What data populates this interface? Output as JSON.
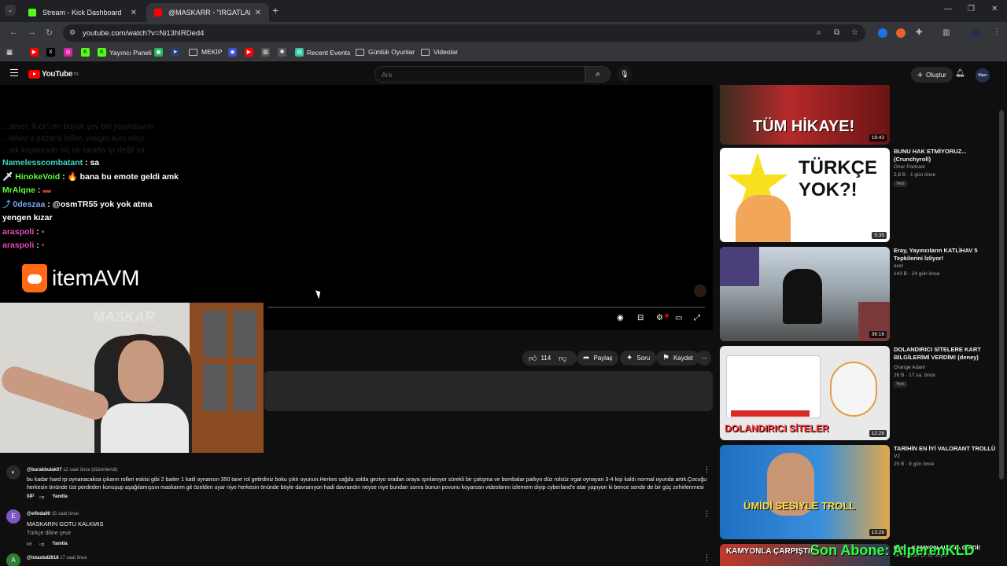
{
  "browser": {
    "tabs": [
      {
        "title": "Stream - Kick Dashboard",
        "favicon_color": "#53fc18",
        "active": false
      },
      {
        "title": "@MASKARR - \"IRGATLARIN GÜ",
        "favicon_color": "#ff0000",
        "active": true
      }
    ],
    "url": "youtube.com/watch?v=Ni13hIRDed4",
    "bookmarks": [
      {
        "label": "",
        "icon": "youtube-icon",
        "color": "#ff0000"
      },
      {
        "label": "",
        "icon": "x-icon",
        "color": "#000000"
      },
      {
        "label": "",
        "icon": "instagram-icon",
        "color": "#d6249f"
      },
      {
        "label": "Yayıncı Paneli",
        "icon": "kick-icon",
        "color": "#53fc18"
      },
      {
        "label": "",
        "icon": "kick-icon",
        "color": "#53fc18"
      },
      {
        "label": "",
        "icon": "app-icon",
        "color": "#1db954"
      },
      {
        "label": "",
        "icon": "arrow-icon",
        "color": "#2a3d74"
      },
      {
        "label": "MEKİP",
        "icon": "folder-icon"
      },
      {
        "label": "",
        "icon": "discord-icon",
        "color": "#3b4cd0"
      },
      {
        "label": "",
        "icon": "youtube-icon",
        "color": "#ff0000"
      },
      {
        "label": "",
        "icon": "image-icon",
        "color": "#555555"
      },
      {
        "label": "",
        "icon": "chatgpt-icon",
        "color": "#555555"
      },
      {
        "label": "Recent Events",
        "icon": "streamlabs-icon",
        "color": "#31c3a2"
      },
      {
        "label": "Günlük Oyunlar",
        "icon": "folder-icon"
      },
      {
        "label": "Videolar",
        "icon": "folder-icon"
      }
    ]
  },
  "youtube": {
    "logo_text": "YouTube",
    "logo_country": "TR",
    "search_placeholder": "Ara",
    "create_label": "Oluştur",
    "avatar_text": "Alper"
  },
  "player": {
    "chat_faded": [
      "...sever, Kick'i en büyük şey biri yayındayım",
      "...lahlar'a pazar'a işliler, yaygın aynı olayı",
      "...sık kapatırsan hiç bir tarafta iyi değil ya"
    ],
    "chat": [
      {
        "user": "Namelesscombatant",
        "message": "sa",
        "color": "#3fd7c6",
        "badge": ""
      },
      {
        "user": "HinokeVoid",
        "message": "🔥 bana bu emote geldi amk",
        "color": "#5efc37",
        "badge": "sword-icon"
      },
      {
        "user": "MrAlqne",
        "message": "▬",
        "color": "#5efc37",
        "badge": ""
      },
      {
        "user": "0deszaa",
        "message": "@osmTR55 yok yok atma",
        "color": "#7aa9ff",
        "badge": "verified-icon"
      },
      {
        "user": "",
        "message": "yengen kızar",
        "color": "#ffffff",
        "badge": ""
      },
      {
        "user": "araspoli",
        "message": "▪",
        "color": "#e74bb8",
        "badge": ""
      },
      {
        "user": "araspoli",
        "message": "▪",
        "color": "#e74bb8",
        "badge": ""
      }
    ],
    "sponsor_text": "itemAVM",
    "webcam_watermark": "MASKAR"
  },
  "actions": {
    "likes": "114",
    "share": "Paylaş",
    "ask": "Soru",
    "save": "Kaydet"
  },
  "comments": [
    {
      "author": "@burakbulak07",
      "time": "12 saat önce (düzenlendi)",
      "avatar_color": "#2a2a2a",
      "avatar_letter": "",
      "text": "bu kadar hard rp oynanacaksa çıkarın rolleri eskisi gibi 2 baiter 1 katil oynansın 350 tane rol getirdiniz boku çıktı oyunun.Herkes sağda solda geziyo oradan oraya ışınlanıyor sürekli bir çatışma ve bombalar patlıyo düz rolsüz ırgat oynayan 3-4 kişi kaldı normal oyunda artık.Çocuğu herkesin önünde üst perdeden konuşup aşağılamışsın maskarım git özelden uyar niye herkesin önünde böyle davranıyon hadi davrandın neyse niye bundan sonra bunun povunu koyarsan videolarını izlemem diyip cyberland'e atar yapıyon ki bence sende de bir güç zehirlenmesi var",
      "reply": "Yanıtla"
    },
    {
      "author": "@elfeda00",
      "time": "15 saat önce",
      "avatar_color": "#7e57c2",
      "avatar_letter": "E",
      "text": "MASKARIN GOTU KALKMIS",
      "translate": "Türkçe diline çevir",
      "reply": "Yanıtla"
    },
    {
      "author": "@lotaxbd2618",
      "time": "17 saat önce",
      "avatar_color": "#2e7d32",
      "avatar_letter": "A",
      "text": "",
      "reply": ""
    }
  ],
  "recommendations": [
    {
      "title": "",
      "channel": "",
      "meta": "",
      "badge": "",
      "duration": "18:43",
      "thumb_text": "TÜM HİKAYE!",
      "thumb_color": "#8b1a1a"
    },
    {
      "title": "BUNU HAK ETMİYORUZ... (Crunchyroll)",
      "channel": "Onur Podcast",
      "meta": "2,8 B · 1 gün önce",
      "badge": "Yeni",
      "duration": "5:35",
      "thumb_text": "TÜRKÇE YOK?!",
      "thumb_color": "#ffffff"
    },
    {
      "title": "Eray, Yayıncıların KATLİHAV 5 Tepkilerini İzliyor!",
      "channel": "axel",
      "meta": "143 B · 24 gün önce",
      "badge": "",
      "duration": "36:16",
      "thumb_text": "",
      "thumb_color": "#6c7a8a"
    },
    {
      "title": "DOLANDIRICI SİTELERE KART BİLGİLERİMİ VERDİM! (deney)",
      "channel": "Orange Adam",
      "meta": "26 B · 17 sa. önce",
      "badge": "Yeni",
      "duration": "12:28",
      "thumb_text": "DOLANDIRICI SİTELER",
      "thumb_color": "#e8e8e8"
    },
    {
      "title": "TARİHİN EN İYİ VALORANT TROLLÜ",
      "channel": "V2",
      "meta": "25 B · 9 gün önce",
      "badge": "",
      "duration": "13:28",
      "thumb_text": "ÜMİDİ SESİYLE TROLL",
      "thumb_color": "#1d6fc2"
    },
    {
      "title": "Eray - KAMYON ALTINA GİRDİ!",
      "channel": "",
      "meta": "ve Kazaları (376) İzliyor",
      "badge": "",
      "duration": "",
      "thumb_text": "KAMYONLA ÇARPIŞTI!",
      "thumb_color": "#c0392b"
    }
  ],
  "overlay": "Son Abone: AlperenKLD",
  "colors": {
    "yt_bg": "#0f0f0f",
    "accent_red": "#ff0000",
    "overlay_green": "#2bff44"
  }
}
